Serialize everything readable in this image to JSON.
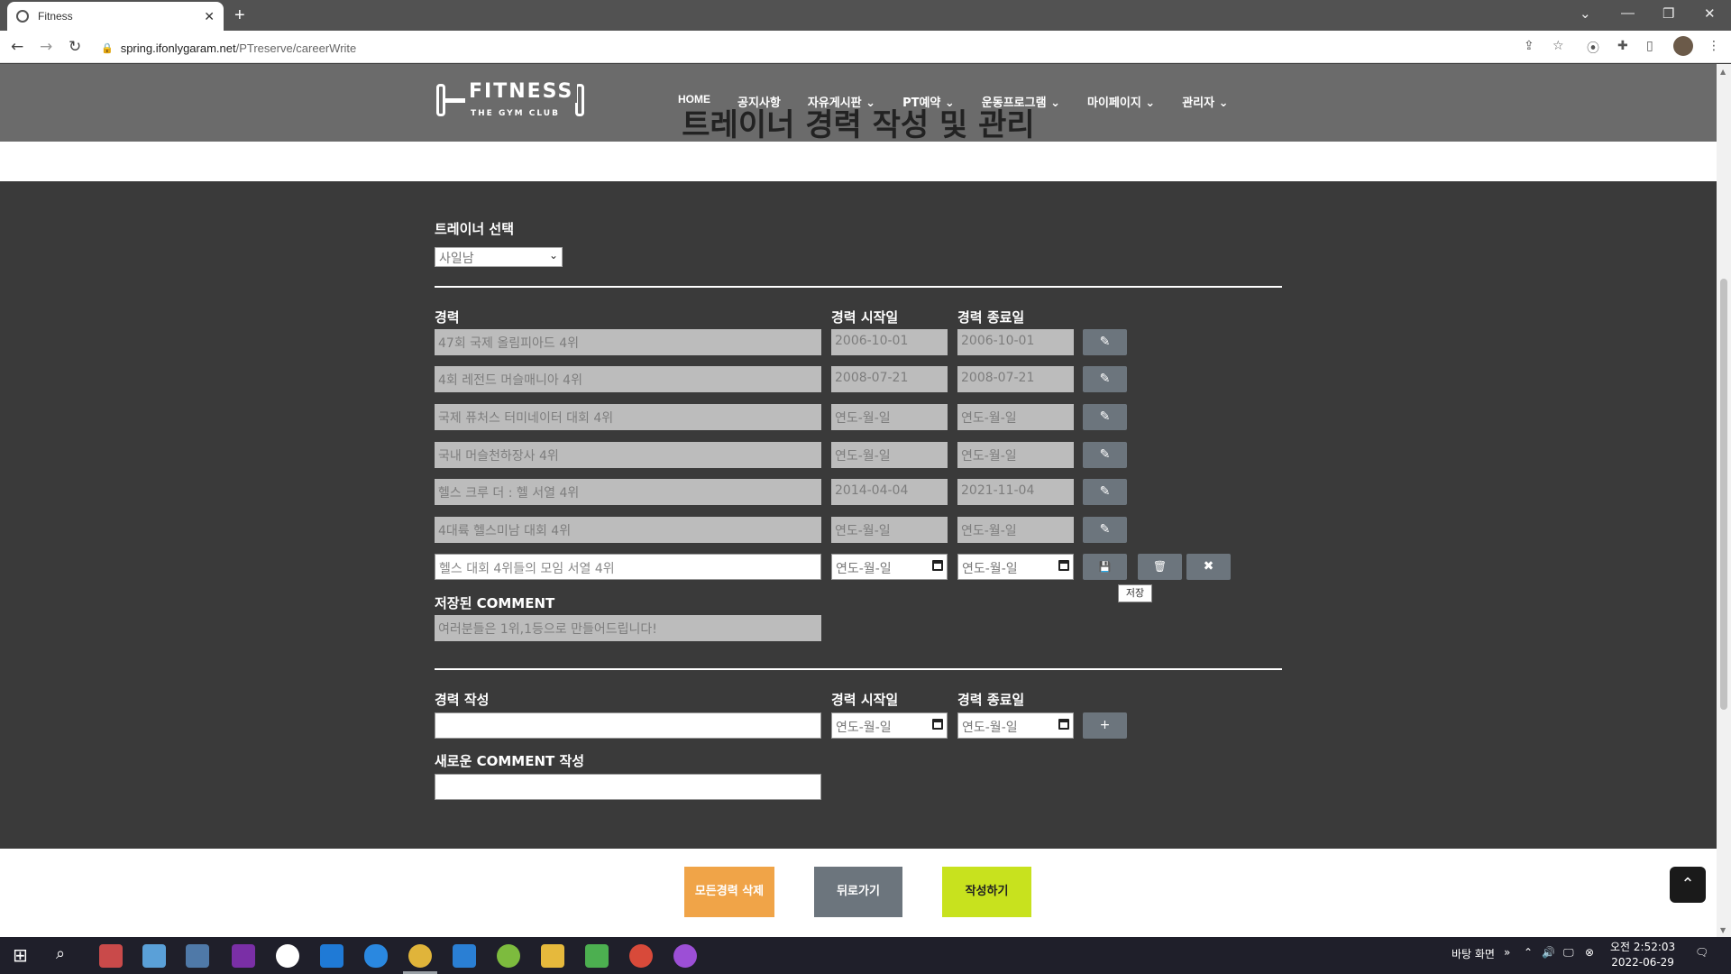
{
  "browser": {
    "tab_title": "Fitness",
    "tab_close": "✕",
    "new_tab": "+",
    "url_host": "spring.ifonlygaram.net",
    "url_path": "/PTreserve/careerWrite",
    "window_controls": [
      "⌄",
      "—",
      "❐",
      "✕"
    ]
  },
  "header": {
    "logo_text": "FITNESS",
    "logo_sub": "THE GYM CLUB",
    "nav": [
      "HOME",
      "공지사항",
      "자유게시판 ⌄",
      "PT예약 ⌄",
      "운동프로그램 ⌄",
      "마이페이지 ⌄",
      "관리자 ⌄"
    ],
    "page_title": "트레이너 경력 작성 및 관리"
  },
  "trainer": {
    "label": "트레이너 선택",
    "selected": "사일남"
  },
  "career_table": {
    "col_career": "경력",
    "col_start": "경력 시작일",
    "col_end": "경력 종료일",
    "rows": [
      {
        "career": "47회 국제 올림피아드 4위",
        "start": "2006-10-01",
        "end": "2006-10-01"
      },
      {
        "career": "4회 레전드 머슬매니아 4위",
        "start": "2008-07-21",
        "end": "2008-07-21"
      },
      {
        "career": "국제 퓨처스 터미네이터 대회 4위",
        "start": "연도-월-일",
        "end": "연도-월-일"
      },
      {
        "career": "국내 머슬천하장사 4위",
        "start": "연도-월-일",
        "end": "연도-월-일"
      },
      {
        "career": "헬스 크루 더 : 헬 서열 4위",
        "start": "2014-04-04",
        "end": "2021-11-04"
      },
      {
        "career": "4대륙 헬스미남 대회 4위",
        "start": "연도-월-일",
        "end": "연도-월-일"
      },
      {
        "career": "헬스 대회 4위들의 모임 서열 4위",
        "start": "연도-월-일",
        "end": "연도-월-일"
      }
    ],
    "edit_icon": "✎",
    "save_icon": "💾",
    "delete_icon": "🗑",
    "cancel_icon": "✖",
    "save_tooltip": "저장"
  },
  "comment": {
    "label": "저장된 COMMENT",
    "value": "여러분들은 1위,1등으로 만들어드립니다!"
  },
  "new_career": {
    "label": "경력 작성",
    "start_label": "경력 시작일",
    "end_label": "경력 종료일",
    "start_placeholder": "연도-월-일",
    "end_placeholder": "연도-월-일",
    "add_label": "+",
    "comment_label": "새로운 COMMENT 작성"
  },
  "footer_buttons": {
    "delete_all": "모든경력 삭제",
    "back": "뒤로가기",
    "submit": "작성하기",
    "to_top": "⌃"
  },
  "colors": {
    "delete_all": "#f0a448",
    "back": "#6c757d",
    "submit": "#c8e21e"
  },
  "taskbar": {
    "desktop_label": "바탕 화면",
    "time": "오전 2:52:03",
    "date": "2022-06-29"
  }
}
